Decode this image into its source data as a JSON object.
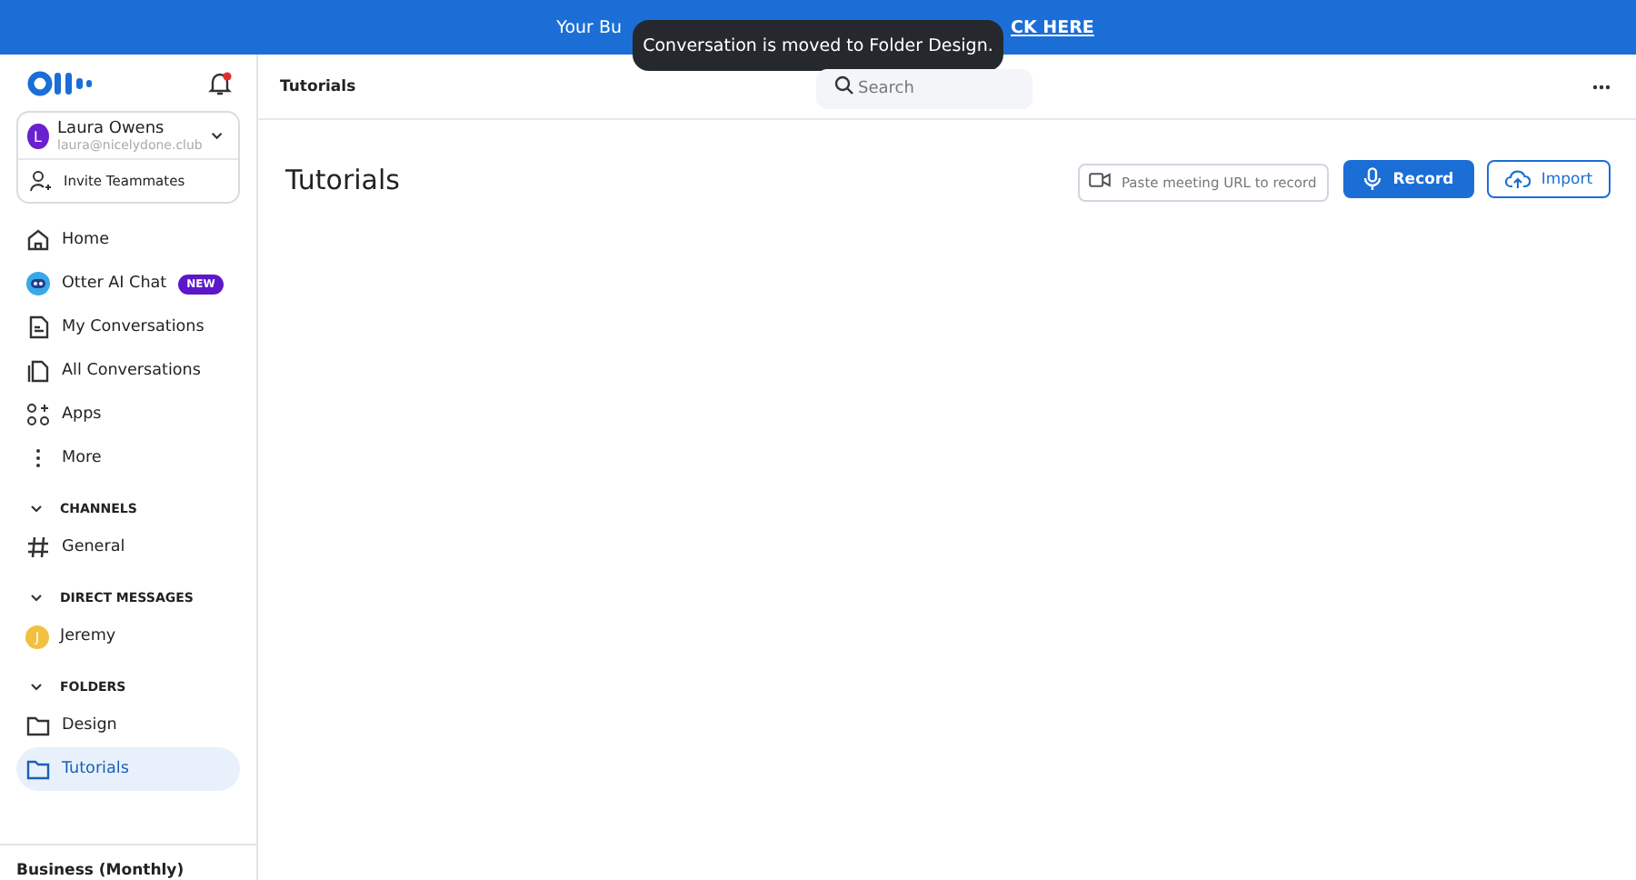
{
  "banner": {
    "text_start": "Your Bu",
    "link": "CK HERE"
  },
  "toast": {
    "text": "Conversation is moved to Folder Design."
  },
  "sidebar": {
    "notifications": {
      "unread": true
    },
    "user": {
      "initial": "L",
      "name": "Laura Owens",
      "email": "laura@nicelydone.club"
    },
    "invite": "Invite Teammates",
    "nav": [
      {
        "label": "Home",
        "selected": false
      },
      {
        "label": "Otter AI Chat",
        "badge": "NEW",
        "selected": false
      },
      {
        "label": "My Conversations",
        "selected": false
      },
      {
        "label": "All Conversations",
        "selected": false
      },
      {
        "label": "Apps",
        "selected": false
      },
      {
        "label": "More",
        "selected": false
      }
    ],
    "sections": [
      {
        "title": "CHANNELS",
        "expanded": true,
        "items": [
          {
            "kind": "channel",
            "label": "General",
            "selected": false
          }
        ]
      },
      {
        "title": "DIRECT MESSAGES",
        "expanded": true,
        "items": [
          {
            "kind": "person",
            "initial": "J",
            "label": "Jeremy",
            "selected": false
          }
        ]
      },
      {
        "title": "FOLDERS",
        "expanded": true,
        "items": [
          {
            "kind": "folder",
            "label": "Design",
            "selected": false
          },
          {
            "kind": "folder",
            "label": "Tutorials",
            "selected": true
          }
        ]
      }
    ],
    "plan": "Business (Monthly)"
  },
  "header": {
    "breadcrumb": "Tutorials",
    "search": {
      "placeholder": "Search"
    }
  },
  "page": {
    "title": "Tutorials",
    "url_field": {
      "placeholder": "Paste meeting URL to record"
    },
    "record": "Record",
    "import": "Import"
  }
}
